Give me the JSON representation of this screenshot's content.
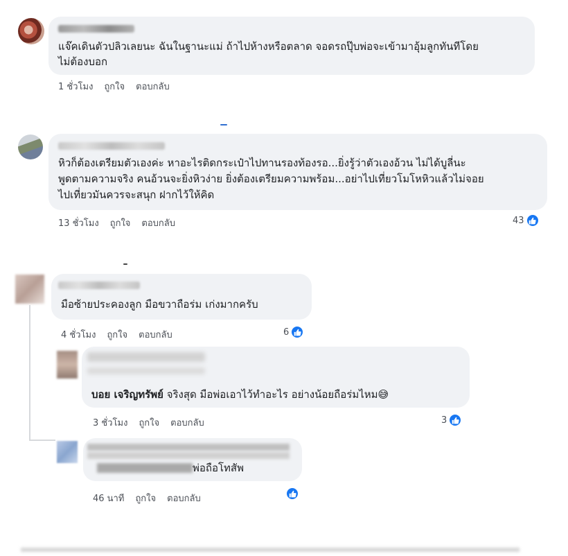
{
  "colors": {
    "bubble": "#f0f2f5",
    "like": "#1877f2",
    "meta": "#4b4f56"
  },
  "comments": [
    {
      "lines": [
        "แจ๊คเดินตัวปลิวเลยนะ ฉันในฐานะแม่ ถ้าไปห้างหรือตลาด จอดรถปุ๊บพ่อจะเข้ามาอุ้มลูกทันทีโดย",
        "ไม่ต้องบอก"
      ],
      "time": "1 ชั่วโมง",
      "like": "ถูกใจ",
      "reply": "ตอบกลับ"
    },
    {
      "lines": [
        "หิวก็ต้องเตรียมตัวเองค่ะ หาอะไรติดกระเป๋าไปทานรองท้องรอ...ยิ่งรู้ว่าตัวเองอ้วน ไม่ได้บูลี่นะ",
        "พูดตามความจริง คนอ้วนจะยิ่งหิวง่าย ยิ่งต้องเตรียมความพร้อม...อย่าไปเที่ยวโมโหหิวแล้วไม่จอย",
        "ไปเที่ยวมันควรจะสนุก ฝากไว้ให้คิด"
      ],
      "time": "13 ชั่วโมง",
      "like": "ถูกใจ",
      "reply": "ตอบกลับ",
      "reactions": "43"
    },
    {
      "lines": [
        "มือซ้ายประคองลูก มือขวาถือร่ม เก่งมากครับ"
      ],
      "time": "4 ชั่วโมง",
      "like": "ถูกใจ",
      "reply": "ตอบกลับ",
      "reactions": "6"
    },
    {
      "mention": "บอย เจริญทรัพย์",
      "text": " จริงสุด มือพ่อเอาไว้ทำอะไร อย่างน้อยถือร่มไหม😅",
      "time": "3 ชั่วโมง",
      "like": "ถูกใจ",
      "reply": "ตอบกลับ",
      "reactions": "3"
    },
    {
      "text": "พ่อถือโทสัพ",
      "time": "46 นาที",
      "like": "ถูกใจ",
      "reply": "ตอบกลับ"
    }
  ]
}
